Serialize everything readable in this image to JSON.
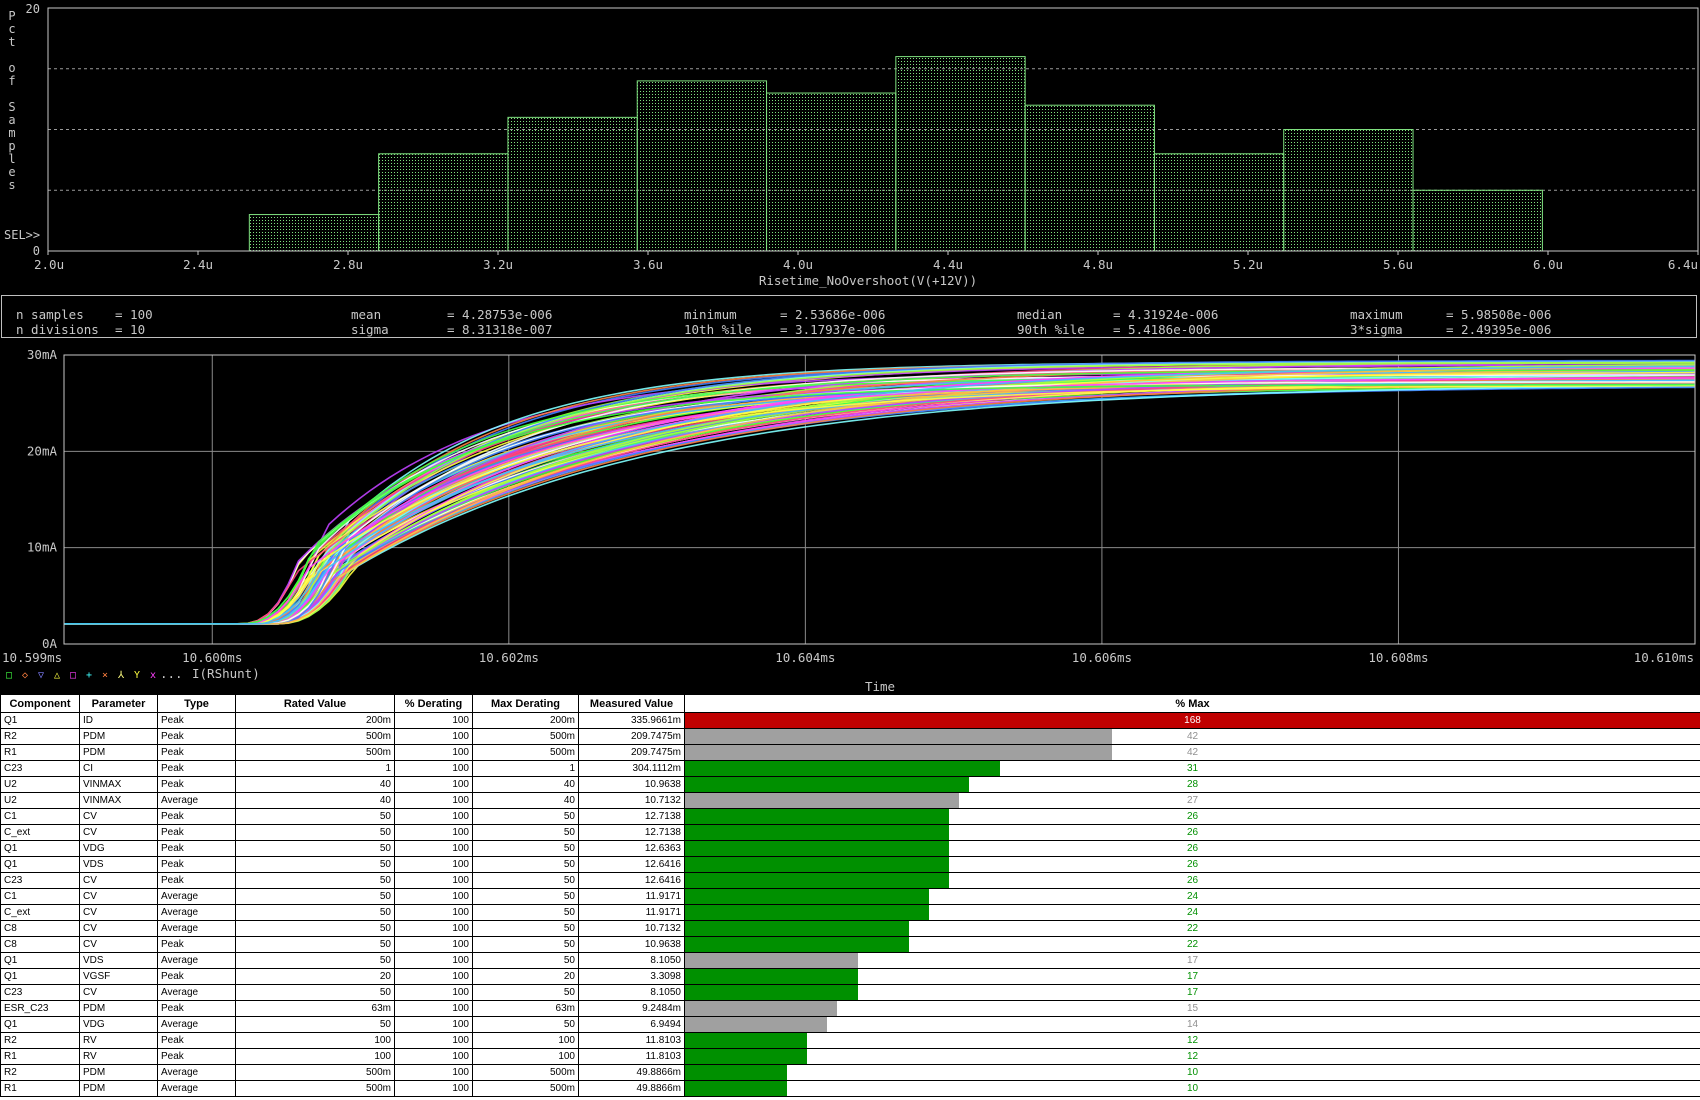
{
  "histogram": {
    "y_axis_label": "Pct of Samples",
    "sel_label": "SEL>>",
    "x_axis_title": "Risetime_NoOvershoot(V(+12V))",
    "y_tick_labels": [
      "20",
      "0"
    ],
    "x_tick_labels": [
      "2.0u",
      "2.4u",
      "2.8u",
      "3.2u",
      "3.6u",
      "4.0u",
      "4.4u",
      "4.8u",
      "5.2u",
      "5.6u",
      "6.0u",
      "6.4u"
    ],
    "colors": {
      "bar": "#7fe07f",
      "grid": "#9a9a9a",
      "axis": "#c8c8c8"
    }
  },
  "chart_data": [
    {
      "type": "bar",
      "title": "",
      "xlabel": "Risetime_NoOvershoot(V(+12V))",
      "ylabel": "Pct of Samples",
      "xlim": [
        2.0,
        6.4
      ],
      "ylim": [
        0,
        20
      ],
      "x_unit": "u",
      "bins": [
        {
          "from": 2.5369,
          "to": 2.8817,
          "pct": 3
        },
        {
          "from": 2.8817,
          "to": 3.2265,
          "pct": 8
        },
        {
          "from": 3.2265,
          "to": 3.5713,
          "pct": 11
        },
        {
          "from": 3.5713,
          "to": 3.9161,
          "pct": 14
        },
        {
          "from": 3.9161,
          "to": 4.2609,
          "pct": 13
        },
        {
          "from": 4.2609,
          "to": 4.6057,
          "pct": 16
        },
        {
          "from": 4.6057,
          "to": 4.9505,
          "pct": 12
        },
        {
          "from": 4.9505,
          "to": 5.2953,
          "pct": 8
        },
        {
          "from": 5.2953,
          "to": 5.6401,
          "pct": 10
        },
        {
          "from": 5.6401,
          "to": 5.9851,
          "pct": 5
        }
      ]
    },
    {
      "type": "line",
      "title": "",
      "xlabel": "Time",
      "ylabel": "",
      "trace_label": "I(RShunt)",
      "legend_prefix": "... ",
      "legend_markers": [
        "□",
        "◇",
        "▽",
        "△",
        "□",
        "+",
        "×",
        "⅄",
        "Y",
        "x"
      ],
      "x_tick_labels": [
        "10.599ms",
        "10.600ms",
        "10.602ms",
        "10.604ms",
        "10.606ms",
        "10.608ms",
        "10.610ms"
      ],
      "y_tick_labels": [
        "30mA",
        "20mA",
        "10mA",
        "0A"
      ],
      "xlim": [
        10.599,
        10.61
      ],
      "ylim": [
        0,
        30
      ],
      "x_unit": "ms",
      "y_unit": "mA",
      "n_traces": 100,
      "baseline_mA": 2.1,
      "step_start_ms": 10.6002,
      "final_range_mA": [
        26.8,
        29.5
      ],
      "trace_colors": [
        "#ffff40",
        "#ff40ff",
        "#40ff40",
        "#40c0ff",
        "#ff8040",
        "#c040ff",
        "#80ffff",
        "#ff4080",
        "#a0ff40",
        "#ffffff",
        "#4080ff",
        "#ffc040"
      ]
    }
  ],
  "stats": {
    "n_samples_label": "n samples",
    "n_samples": "= 100",
    "n_divisions_label": "n divisions",
    "n_divisions": "= 10",
    "mean_label": "mean",
    "mean": "= 4.28753e-006",
    "sigma_label": "sigma",
    "sigma": "= 8.31318e-007",
    "minimum_label": "minimum",
    "minimum": "= 2.53686e-006",
    "p10_label": "10th %ile",
    "p10": "= 3.17937e-006",
    "median_label": "median",
    "median": "= 4.31924e-006",
    "p90_label": "90th %ile",
    "p90": "= 5.4186e-006",
    "maximum_label": "maximum",
    "maximum": "= 5.98508e-006",
    "three_sigma_label": "3*sigma",
    "three_sigma": "= 2.49395e-006"
  },
  "table": {
    "headers": [
      "Component",
      "Parameter",
      "Type",
      "Rated Value",
      "% Derating",
      "Max Derating",
      "Measured Value",
      "% Max"
    ],
    "colors": {
      "over": "#c00000",
      "ok": "#009000",
      "na": "#a0a0a0"
    },
    "rows": [
      {
        "component": "Q1",
        "parameter": "ID",
        "type": "Peak",
        "rated": "200m",
        "derating": "100",
        "max": "200m",
        "measured": "335.9661m",
        "pct": "168",
        "pct_value": 168,
        "status": "over"
      },
      {
        "component": "R2",
        "parameter": "PDM",
        "type": "Peak",
        "rated": "500m",
        "derating": "100",
        "max": "500m",
        "measured": "209.7475m",
        "pct": "42",
        "pct_value": 42,
        "status": "na"
      },
      {
        "component": "R1",
        "parameter": "PDM",
        "type": "Peak",
        "rated": "500m",
        "derating": "100",
        "max": "500m",
        "measured": "209.7475m",
        "pct": "42",
        "pct_value": 42,
        "status": "na"
      },
      {
        "component": "C23",
        "parameter": "CI",
        "type": "Peak",
        "rated": "1",
        "derating": "100",
        "max": "1",
        "measured": "304.1112m",
        "pct": "31",
        "pct_value": 31,
        "status": "ok"
      },
      {
        "component": "U2",
        "parameter": "VINMAX",
        "type": "Peak",
        "rated": "40",
        "derating": "100",
        "max": "40",
        "measured": "10.9638",
        "pct": "28",
        "pct_value": 28,
        "status": "ok"
      },
      {
        "component": "U2",
        "parameter": "VINMAX",
        "type": "Average",
        "rated": "40",
        "derating": "100",
        "max": "40",
        "measured": "10.7132",
        "pct": "27",
        "pct_value": 27,
        "status": "na"
      },
      {
        "component": "C1",
        "parameter": "CV",
        "type": "Peak",
        "rated": "50",
        "derating": "100",
        "max": "50",
        "measured": "12.7138",
        "pct": "26",
        "pct_value": 26,
        "status": "ok"
      },
      {
        "component": "C_ext",
        "parameter": "CV",
        "type": "Peak",
        "rated": "50",
        "derating": "100",
        "max": "50",
        "measured": "12.7138",
        "pct": "26",
        "pct_value": 26,
        "status": "ok"
      },
      {
        "component": "Q1",
        "parameter": "VDG",
        "type": "Peak",
        "rated": "50",
        "derating": "100",
        "max": "50",
        "measured": "12.6363",
        "pct": "26",
        "pct_value": 26,
        "status": "ok"
      },
      {
        "component": "Q1",
        "parameter": "VDS",
        "type": "Peak",
        "rated": "50",
        "derating": "100",
        "max": "50",
        "measured": "12.6416",
        "pct": "26",
        "pct_value": 26,
        "status": "ok"
      },
      {
        "component": "C23",
        "parameter": "CV",
        "type": "Peak",
        "rated": "50",
        "derating": "100",
        "max": "50",
        "measured": "12.6416",
        "pct": "26",
        "pct_value": 26,
        "status": "ok"
      },
      {
        "component": "C1",
        "parameter": "CV",
        "type": "Average",
        "rated": "50",
        "derating": "100",
        "max": "50",
        "measured": "11.9171",
        "pct": "24",
        "pct_value": 24,
        "status": "ok"
      },
      {
        "component": "C_ext",
        "parameter": "CV",
        "type": "Average",
        "rated": "50",
        "derating": "100",
        "max": "50",
        "measured": "11.9171",
        "pct": "24",
        "pct_value": 24,
        "status": "ok"
      },
      {
        "component": "C8",
        "parameter": "CV",
        "type": "Average",
        "rated": "50",
        "derating": "100",
        "max": "50",
        "measured": "10.7132",
        "pct": "22",
        "pct_value": 22,
        "status": "ok"
      },
      {
        "component": "C8",
        "parameter": "CV",
        "type": "Peak",
        "rated": "50",
        "derating": "100",
        "max": "50",
        "measured": "10.9638",
        "pct": "22",
        "pct_value": 22,
        "status": "ok"
      },
      {
        "component": "Q1",
        "parameter": "VDS",
        "type": "Average",
        "rated": "50",
        "derating": "100",
        "max": "50",
        "measured": "8.1050",
        "pct": "17",
        "pct_value": 17,
        "status": "na"
      },
      {
        "component": "Q1",
        "parameter": "VGSF",
        "type": "Peak",
        "rated": "20",
        "derating": "100",
        "max": "20",
        "measured": "3.3098",
        "pct": "17",
        "pct_value": 17,
        "status": "ok"
      },
      {
        "component": "C23",
        "parameter": "CV",
        "type": "Average",
        "rated": "50",
        "derating": "100",
        "max": "50",
        "measured": "8.1050",
        "pct": "17",
        "pct_value": 17,
        "status": "ok"
      },
      {
        "component": "ESR_C23",
        "parameter": "PDM",
        "type": "Peak",
        "rated": "63m",
        "derating": "100",
        "max": "63m",
        "measured": "9.2484m",
        "pct": "15",
        "pct_value": 15,
        "status": "na"
      },
      {
        "component": "Q1",
        "parameter": "VDG",
        "type": "Average",
        "rated": "50",
        "derating": "100",
        "max": "50",
        "measured": "6.9494",
        "pct": "14",
        "pct_value": 14,
        "status": "na"
      },
      {
        "component": "R2",
        "parameter": "RV",
        "type": "Peak",
        "rated": "100",
        "derating": "100",
        "max": "100",
        "measured": "11.8103",
        "pct": "12",
        "pct_value": 12,
        "status": "ok"
      },
      {
        "component": "R1",
        "parameter": "RV",
        "type": "Peak",
        "rated": "100",
        "derating": "100",
        "max": "100",
        "measured": "11.8103",
        "pct": "12",
        "pct_value": 12,
        "status": "ok"
      },
      {
        "component": "R2",
        "parameter": "PDM",
        "type": "Average",
        "rated": "500m",
        "derating": "100",
        "max": "500m",
        "measured": "49.8866m",
        "pct": "10",
        "pct_value": 10,
        "status": "ok"
      },
      {
        "component": "R1",
        "parameter": "PDM",
        "type": "Average",
        "rated": "500m",
        "derating": "100",
        "max": "500m",
        "measured": "49.8866m",
        "pct": "10",
        "pct_value": 10,
        "status": "ok"
      }
    ]
  }
}
